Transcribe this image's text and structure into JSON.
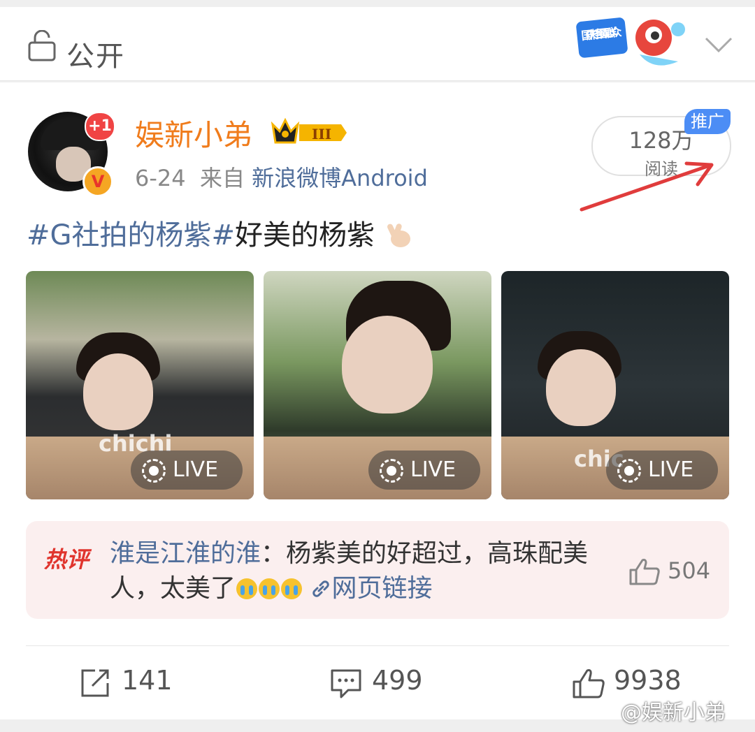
{
  "header": {
    "visibility": "公开",
    "promo_banner_text": "国庆档围观群众"
  },
  "post": {
    "author": "娱新小弟",
    "avatar_badge": "+1",
    "verified_mark": "V",
    "level_badge": "III",
    "date": "6-24",
    "source_prefix": "来自",
    "source": "新浪微博Android",
    "reads_count": "128万",
    "reads_label": "阅读",
    "promoted_tag": "推广",
    "text_tag": "#G社拍的杨紫#",
    "text_body": "好美的杨紫",
    "photos": [
      {
        "live_label": "LIVE",
        "watermark": "chichi"
      },
      {
        "live_label": "LIVE",
        "watermark": ""
      },
      {
        "live_label": "LIVE",
        "watermark": "chic"
      }
    ]
  },
  "hot_comment": {
    "badge": "热评",
    "user": "淮是江淮的淮",
    "separator": "：",
    "text": "杨紫美的好超过，高珠配美人，太美了",
    "link_label": "网页链接",
    "likes": "504"
  },
  "actions": {
    "reposts": "141",
    "comments": "499",
    "likes": "9938"
  },
  "watermark": "@娱新小弟",
  "colors": {
    "accent": "#f07c1c",
    "link": "#4f6d9a",
    "promo": "#4c8df5",
    "hot": "#e0342d"
  }
}
